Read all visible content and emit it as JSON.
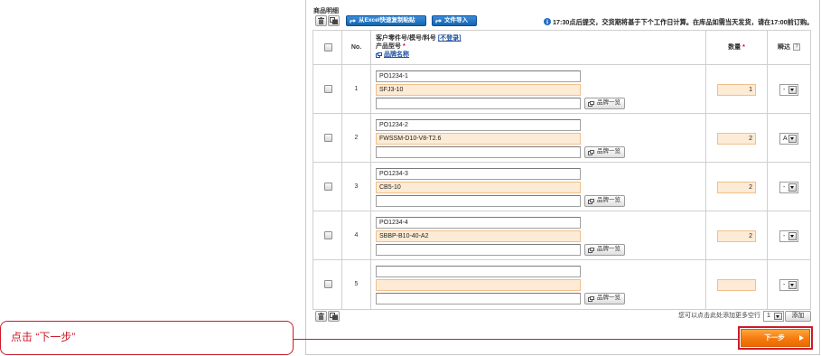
{
  "section_title": "商品明细",
  "toolbar": {
    "excel_paste_label": "从Excel快速复制粘贴",
    "file_import_label": "文件导入",
    "notice": "17:30点后提交，交货期将基于下个工作日计算。在库品如需当天发货，请在17:00前订购。"
  },
  "table": {
    "headers": {
      "no": "No.",
      "part_number": "客户零件号/模号/料号",
      "no_register_link": "[不登录]",
      "model": "产品型号",
      "brand": "品牌名称",
      "quantity": "数量",
      "delivery": "瞬达",
      "required_mark": "*",
      "help": "?"
    },
    "brand_list_label": "品牌一览",
    "rows": [
      {
        "no": "1",
        "part_number": "PO1234-1",
        "model": "SFJ3-10",
        "brand": "",
        "quantity": "1",
        "delivery": "-"
      },
      {
        "no": "2",
        "part_number": "PO1234-2",
        "model": "FWSSM-D10-V8-T2.6",
        "brand": "",
        "quantity": "2",
        "delivery": "A"
      },
      {
        "no": "3",
        "part_number": "PO1234-3",
        "model": "CB5-10",
        "brand": "",
        "quantity": "2",
        "delivery": "-"
      },
      {
        "no": "4",
        "part_number": "PO1234-4",
        "model": "SBBP-B10-40-A2",
        "brand": "",
        "quantity": "2",
        "delivery": "-"
      },
      {
        "no": "5",
        "part_number": "",
        "model": "",
        "brand": "",
        "quantity": "",
        "delivery": "-"
      }
    ]
  },
  "footer": {
    "add_rows_hint": "您可以点击此处添加更多空行",
    "add_count": "1",
    "add_button": "添加"
  },
  "next_button": "下一步",
  "callout": "点击 “下一步”",
  "icons": {
    "delete": "trash-icon",
    "copy": "copy-icon",
    "paste": "paste-icon",
    "import": "import-icon",
    "info": "info-icon",
    "brand_list": "window-icon",
    "dropdown": "chevron-down-icon",
    "next": "arrow-right-icon"
  },
  "colors": {
    "accent_blue": "#1565b0",
    "next_orange": "#f47a0e",
    "highlight_red": "#cc1b2b",
    "required_bg": "#fdebd5",
    "link_blue": "#1a4ea0"
  }
}
